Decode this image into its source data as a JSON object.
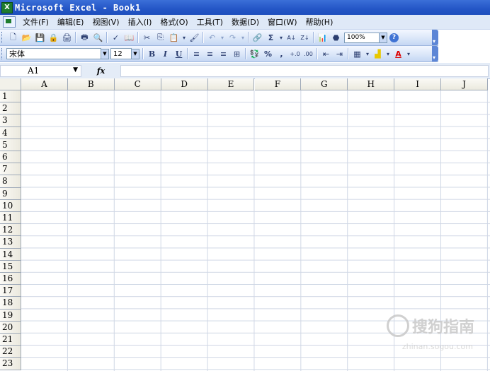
{
  "window": {
    "title": "Microsoft Excel - Book1",
    "app_icon": "X"
  },
  "menu": [
    "文件(F)",
    "编辑(E)",
    "视图(V)",
    "插入(I)",
    "格式(O)",
    "工具(T)",
    "数据(D)",
    "窗口(W)",
    "帮助(H)"
  ],
  "standard_toolbar": {
    "buttons": [
      "🗋",
      "📂",
      "💾",
      "🔒",
      "🖨",
      "🖶",
      "🔍",
      "✓",
      "📖",
      "✂",
      "⎘",
      "📋",
      "▾",
      "🖌",
      "↶",
      "▾",
      "↷",
      "▾",
      "🔗",
      "Σ",
      "▾",
      "A↓",
      "Z↓",
      "📊",
      "⬣"
    ],
    "zoom": "100%",
    "help": "?"
  },
  "format_toolbar": {
    "font": "宋体",
    "size": "12",
    "bold": "B",
    "italic": "I",
    "underline": "U",
    "align": [
      "≡",
      "≡",
      "≡",
      "⊞"
    ],
    "misc": [
      "💱",
      "%",
      ",",
      "+.0",
      ".00",
      "⇤",
      "⇥",
      "▦",
      "▾",
      "▟",
      "▾",
      "A",
      "▾"
    ]
  },
  "formula_bar": {
    "name_box": "A1",
    "fx": "fx"
  },
  "columns": [
    "A",
    "B",
    "C",
    "D",
    "E",
    "F",
    "G",
    "H",
    "I",
    "J"
  ],
  "rows": [
    "1",
    "2",
    "3",
    "4",
    "5",
    "6",
    "7",
    "8",
    "9",
    "10",
    "11",
    "12",
    "13",
    "14",
    "15",
    "16",
    "17",
    "18",
    "19",
    "20",
    "21",
    "22",
    "23"
  ],
  "watermark": {
    "main": "搜狗指南",
    "sub": "zhinan.sogou.com"
  },
  "colors": {
    "title_bar": "#2456c6",
    "menu_bar": "#dfe9f7",
    "header": "#ebe9de",
    "gridline": "#d0d7e5"
  }
}
